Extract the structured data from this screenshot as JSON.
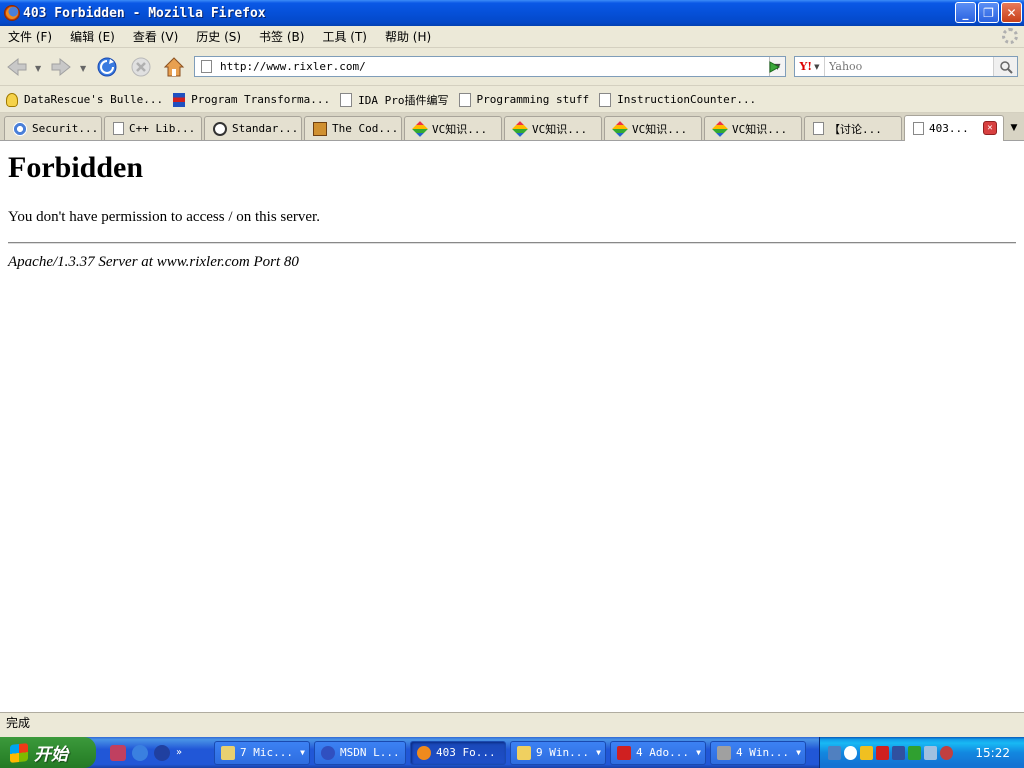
{
  "window": {
    "title": "403 Forbidden - Mozilla Firefox"
  },
  "menu": [
    "文件 (F)",
    "编辑 (E)",
    "查看 (V)",
    "历史 (S)",
    "书签 (B)",
    "工具 (T)",
    "帮助 (H)"
  ],
  "nav": {
    "url": "http://www.rixler.com/",
    "search_placeholder": "Yahoo",
    "search_engine_logo": "Y!"
  },
  "bookmarks": [
    {
      "label": "DataRescue's Bulle...",
      "icon": "bulb-icon"
    },
    {
      "label": "Program Transforma...",
      "icon": "flag-icon"
    },
    {
      "label": "IDA Pro插件编写",
      "icon": "page-icon"
    },
    {
      "label": "Programming stuff",
      "icon": "page-icon"
    },
    {
      "label": "InstructionCounter...",
      "icon": "page-icon"
    }
  ],
  "tabs": [
    {
      "label": "Securit...",
      "icon": "swirl"
    },
    {
      "label": "C++ Lib...",
      "icon": "page"
    },
    {
      "label": "Standar...",
      "icon": "circle"
    },
    {
      "label": "The Cod...",
      "icon": "book"
    },
    {
      "label": "VC知识...",
      "icon": "diamond"
    },
    {
      "label": "VC知识...",
      "icon": "diamond"
    },
    {
      "label": "VC知识...",
      "icon": "diamond"
    },
    {
      "label": "VC知识...",
      "icon": "diamond"
    },
    {
      "label": "【讨论...",
      "icon": "page"
    },
    {
      "label": "403...",
      "icon": "page",
      "active": true
    }
  ],
  "page": {
    "heading": "Forbidden",
    "message": "You don't have permission to access / on this server.",
    "footer": "Apache/1.3.37 Server at www.rixler.com Port 80"
  },
  "status": {
    "text": "完成"
  },
  "taskbar": {
    "start_label": "开始",
    "tasks": [
      {
        "label": "7 Mic...",
        "color": "#e8d070",
        "arrow": true
      },
      {
        "label": "MSDN L...",
        "color": "#3050c0",
        "arrow": false
      },
      {
        "label": "403 Fo...",
        "color": "#f08a1c",
        "arrow": false,
        "active": true
      },
      {
        "label": "9 Win...",
        "color": "#f0d060",
        "arrow": true
      },
      {
        "label": "4 Ado...",
        "color": "#d02020",
        "arrow": true
      },
      {
        "label": "4 Win...",
        "color": "#a0a0a0",
        "arrow": true
      }
    ],
    "clock": "15:22"
  }
}
